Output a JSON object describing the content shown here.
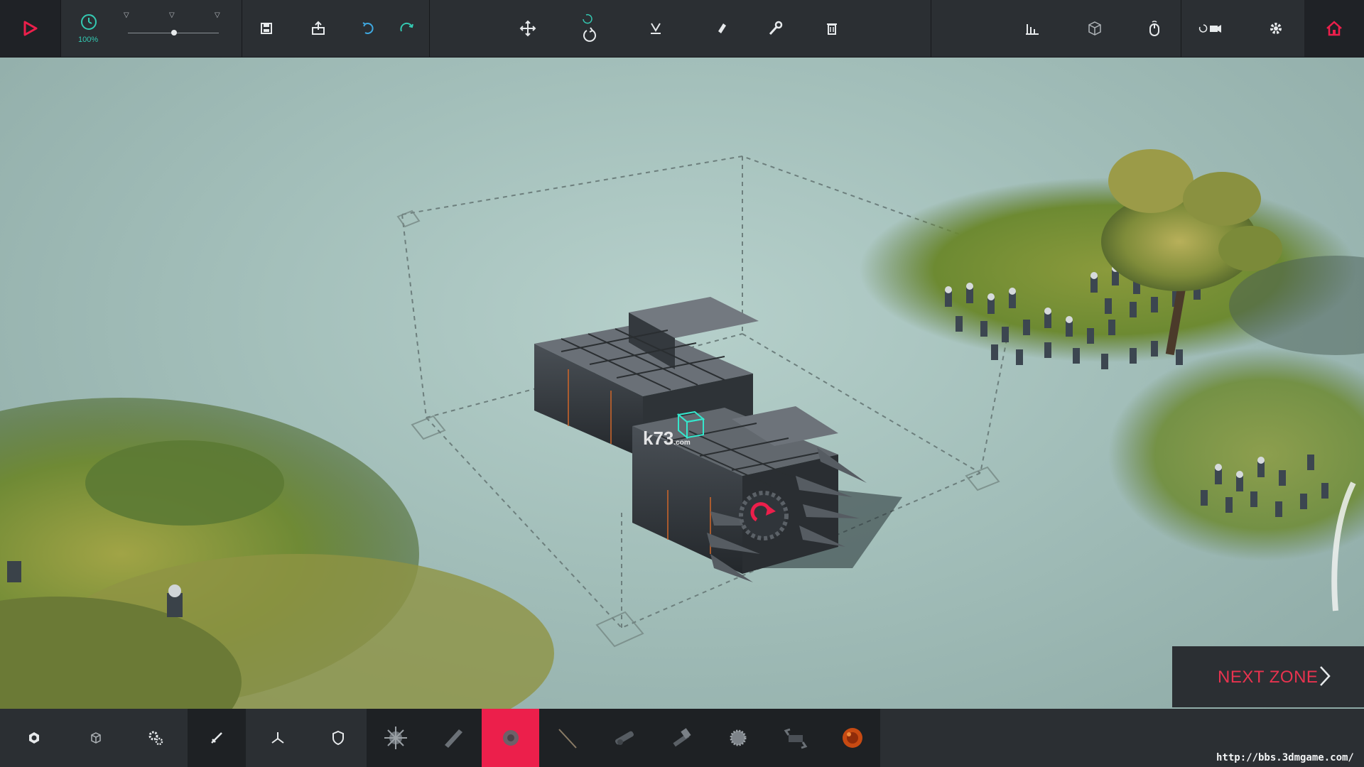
{
  "toolbar": {
    "speed_label": "100%",
    "icons": [
      "play-icon",
      "clock-icon",
      "save-icon",
      "load-icon",
      "undo-icon",
      "redo-icon",
      "move-icon",
      "rotate-icon",
      "flip-icon",
      "ground-icon",
      "eraser-icon",
      "wrench-icon",
      "trash-icon",
      "stats-icon",
      "cube-icon",
      "mouse-icon",
      "camera-swap-icon",
      "settings-icon",
      "home-icon"
    ]
  },
  "next_zone": {
    "label": "NEXT ZONE"
  },
  "blocks_bar": {
    "selected": "wheel",
    "categories": [
      "basic-block",
      "cube-block",
      "gears",
      "weapons",
      "flight",
      "armour"
    ],
    "items": [
      "spiked-ball",
      "blade",
      "wheel",
      "spear",
      "cannon",
      "crossbow",
      "spike-mine",
      "grabber",
      "bomb"
    ]
  },
  "overlay": {
    "logo": "k73",
    "logo_sub": ".com"
  },
  "watermark": "http://bbs.3dmgame.com/",
  "colors": {
    "accent": "#ec1f4b",
    "teal": "#34c9b2",
    "bar": "#2b2f33"
  }
}
